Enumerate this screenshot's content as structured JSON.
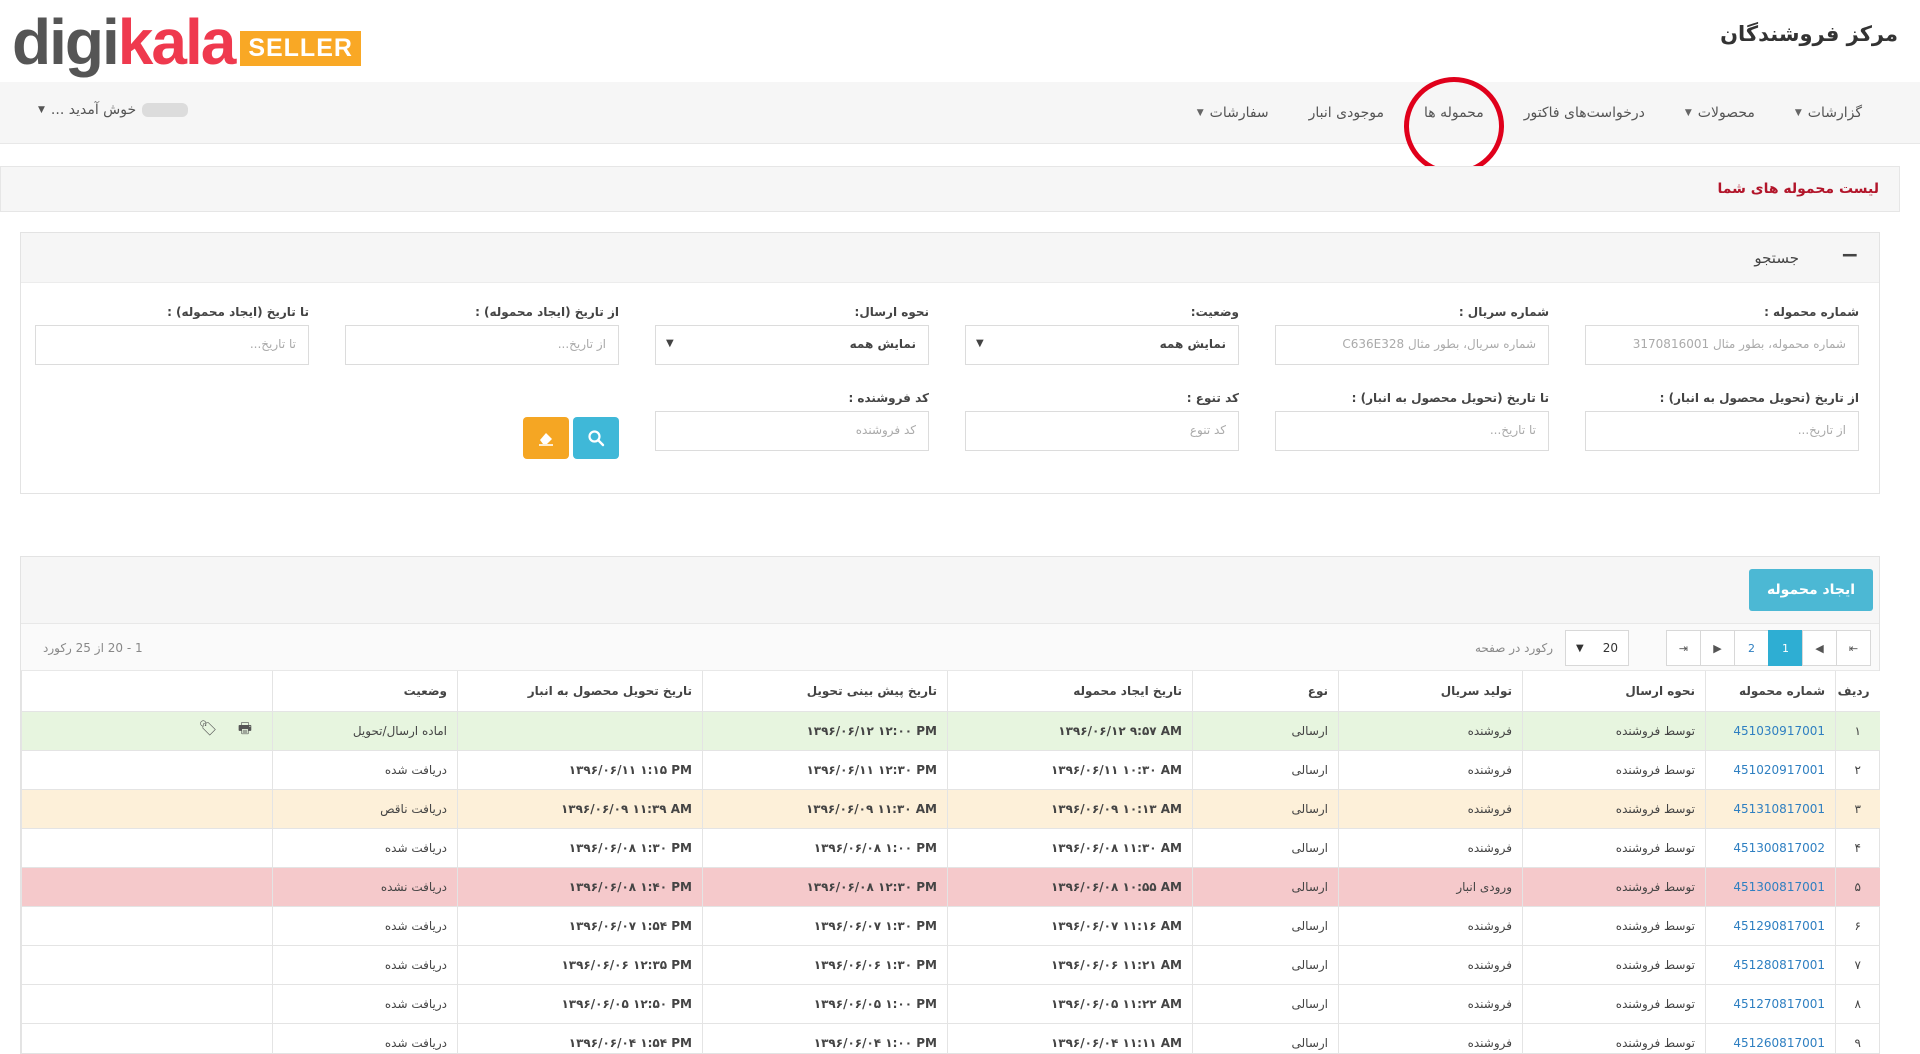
{
  "brand": {
    "logo_digi": "digi",
    "logo_kala": "kala",
    "logo_seller": "SELLER",
    "title": "مرکز فروشندگان"
  },
  "nav": {
    "items": [
      {
        "label": "سفارشات",
        "caret": true
      },
      {
        "label": "موجودی انبار",
        "caret": false
      },
      {
        "label": "محموله ها",
        "caret": false,
        "highlighted": true
      },
      {
        "label": "درخواست‌های فاکتور",
        "caret": false
      },
      {
        "label": "محصولات",
        "caret": true
      },
      {
        "label": "گزارشات",
        "caret": true
      }
    ],
    "welcome": "خوش آمدید ..."
  },
  "page_title": "لیست محموله های شما",
  "search": {
    "title": "جستجو",
    "fields": {
      "shipment_number": {
        "label": "شماره محموله :",
        "placeholder": "شماره محموله، بطور مثال 3170816001"
      },
      "serial_number": {
        "label": "شماره سریال :",
        "placeholder": "شماره سریال، بطور مثال C636E328"
      },
      "status": {
        "label": "وضعیت:",
        "value": "نمایش همه"
      },
      "send_method": {
        "label": "نحوه ارسال:",
        "value": "نمایش همه"
      },
      "created_from": {
        "label": "از تاریخ (ایجاد محموله) :",
        "placeholder": "از تاریخ..."
      },
      "created_to": {
        "label": "تا تاریخ (ایجاد محموله) :",
        "placeholder": "تا تاریخ..."
      },
      "delivered_from": {
        "label": "از تاریخ (تحویل محصول به انبار) :",
        "placeholder": "از تاریخ..."
      },
      "delivered_to": {
        "label": "تا تاریخ (تحویل محصول به انبار) :",
        "placeholder": "تا تاریخ..."
      },
      "variant_code": {
        "label": "کد تنوع :",
        "placeholder": "کد تنوع"
      },
      "seller_code": {
        "label": "کد فروشنده :",
        "placeholder": "کد فروشنده"
      }
    },
    "search_icon": "search-icon",
    "clear_icon": "eraser-icon",
    "accent_color": "#3fb8d8",
    "clear_color": "#f5a623"
  },
  "grid": {
    "create_button": "ایجاد محموله",
    "per_page_value": "20",
    "per_page_label": "رکورد در صفحه",
    "record_count": "1 - 20 از 25 رکورد",
    "pages": [
      "1",
      "2"
    ],
    "current_page": "1",
    "columns": [
      "ردیف",
      "شماره محموله",
      "نحوه ارسال",
      "تولید سریال",
      "نوع",
      "تاریخ ایجاد محموله",
      "تاریخ پیش بینی تحویل",
      "تاریخ تحویل محصول به انبار",
      "وضعیت",
      ""
    ],
    "rows": [
      {
        "idx": "۱",
        "number": "451030917001",
        "method": "توسط فروشنده",
        "serial": "فروشنده",
        "type": "ارسالی",
        "created": "۱۳۹۶/۰۶/۱۲ ۹:۵۷ AM",
        "expected": "۱۳۹۶/۰۶/۱۲ ۱۲:۰۰ PM",
        "delivered": "",
        "status": "اماده ارسال/تحویل",
        "tone": "green",
        "actions": true
      },
      {
        "idx": "۲",
        "number": "451020917001",
        "method": "توسط فروشنده",
        "serial": "فروشنده",
        "type": "ارسالی",
        "created": "۱۳۹۶/۰۶/۱۱ ۱۰:۳۰ AM",
        "expected": "۱۳۹۶/۰۶/۱۱ ۱۲:۳۰ PM",
        "delivered": "۱۳۹۶/۰۶/۱۱ ۱:۱۵ PM",
        "status": "دریافت شده",
        "tone": "",
        "actions": false
      },
      {
        "idx": "۳",
        "number": "451310817001",
        "method": "توسط فروشنده",
        "serial": "فروشنده",
        "type": "ارسالی",
        "created": "۱۳۹۶/۰۶/۰۹ ۱۰:۱۳ AM",
        "expected": "۱۳۹۶/۰۶/۰۹ ۱۱:۳۰ AM",
        "delivered": "۱۳۹۶/۰۶/۰۹ ۱۱:۳۹ AM",
        "status": "دریافت ناقص",
        "tone": "amber",
        "actions": false
      },
      {
        "idx": "۴",
        "number": "451300817002",
        "method": "توسط فروشنده",
        "serial": "فروشنده",
        "type": "ارسالی",
        "created": "۱۳۹۶/۰۶/۰۸ ۱۱:۳۰ AM",
        "expected": "۱۳۹۶/۰۶/۰۸ ۱:۰۰ PM",
        "delivered": "۱۳۹۶/۰۶/۰۸ ۱:۳۰ PM",
        "status": "دریافت شده",
        "tone": "",
        "actions": false
      },
      {
        "idx": "۵",
        "number": "451300817001",
        "method": "توسط فروشنده",
        "serial": "ورودی انبار",
        "type": "ارسالی",
        "created": "۱۳۹۶/۰۶/۰۸ ۱۰:۵۵ AM",
        "expected": "۱۳۹۶/۰۶/۰۸ ۱۲:۳۰ PM",
        "delivered": "۱۳۹۶/۰۶/۰۸ ۱:۴۰ PM",
        "status": "دریافت نشده",
        "tone": "red",
        "actions": false
      },
      {
        "idx": "۶",
        "number": "451290817001",
        "method": "توسط فروشنده",
        "serial": "فروشنده",
        "type": "ارسالی",
        "created": "۱۳۹۶/۰۶/۰۷ ۱۱:۱۶ AM",
        "expected": "۱۳۹۶/۰۶/۰۷ ۱:۳۰ PM",
        "delivered": "۱۳۹۶/۰۶/۰۷ ۱:۵۴ PM",
        "status": "دریافت شده",
        "tone": "",
        "actions": false
      },
      {
        "idx": "۷",
        "number": "451280817001",
        "method": "توسط فروشنده",
        "serial": "فروشنده",
        "type": "ارسالی",
        "created": "۱۳۹۶/۰۶/۰۶ ۱۱:۲۱ AM",
        "expected": "۱۳۹۶/۰۶/۰۶ ۱:۳۰ PM",
        "delivered": "۱۳۹۶/۰۶/۰۶ ۱۲:۳۵ PM",
        "status": "دریافت شده",
        "tone": "",
        "actions": false
      },
      {
        "idx": "۸",
        "number": "451270817001",
        "method": "توسط فروشنده",
        "serial": "فروشنده",
        "type": "ارسالی",
        "created": "۱۳۹۶/۰۶/۰۵ ۱۱:۲۲ AM",
        "expected": "۱۳۹۶/۰۶/۰۵ ۱:۰۰ PM",
        "delivered": "۱۳۹۶/۰۶/۰۵ ۱۲:۵۰ PM",
        "status": "دریافت شده",
        "tone": "",
        "actions": false
      },
      {
        "idx": "۹",
        "number": "451260817001",
        "method": "توسط فروشنده",
        "serial": "فروشنده",
        "type": "ارسالی",
        "created": "۱۳۹۶/۰۶/۰۴ ۱۱:۱۱ AM",
        "expected": "۱۳۹۶/۰۶/۰۴ ۱:۰۰ PM",
        "delivered": "۱۳۹۶/۰۶/۰۴ ۱:۵۴ PM",
        "status": "دریافت شده",
        "tone": "",
        "actions": false
      }
    ],
    "row_colors": {
      "green": "#e7f5df",
      "amber": "#fdf0d9",
      "red": "#f5c9cb"
    },
    "action_icons": [
      "print-icon",
      "tag-icon"
    ]
  }
}
